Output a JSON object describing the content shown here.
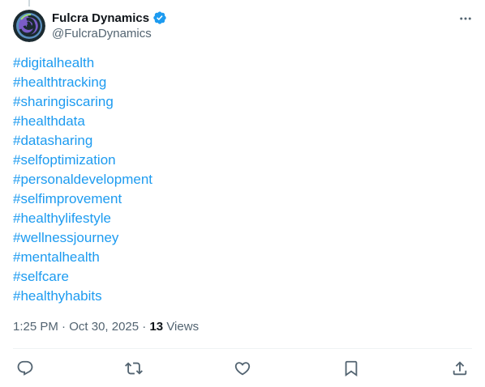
{
  "author": {
    "display_name": "Fulcra Dynamics",
    "handle": "@FulcraDynamics",
    "verified": true
  },
  "hashtags": [
    "#digitalhealth",
    "#healthtracking",
    "#sharingiscaring",
    "#healthdata",
    "#datasharing",
    "#selfoptimization",
    "#personaldevelopment",
    "#selfimprovement",
    "#healthylifestyle",
    "#wellnessjourney",
    "#mentalhealth",
    "#selfcare",
    "#healthyhabits"
  ],
  "meta": {
    "time": "1:25 PM",
    "separator": "·",
    "date": "Oct 30, 2025",
    "views_count": "13",
    "views_label": "Views"
  },
  "icons": {
    "more": "more-horizontal-icon",
    "verified": "verified-badge-icon",
    "reply": "reply-icon",
    "repost": "repost-icon",
    "like": "like-icon",
    "bookmark": "bookmark-icon",
    "share": "share-icon"
  },
  "colors": {
    "link": "#1d9bf0",
    "text": "#0f1419",
    "secondary": "#536471",
    "verified": "#1d9bf0",
    "divider": "#eff3f4"
  }
}
